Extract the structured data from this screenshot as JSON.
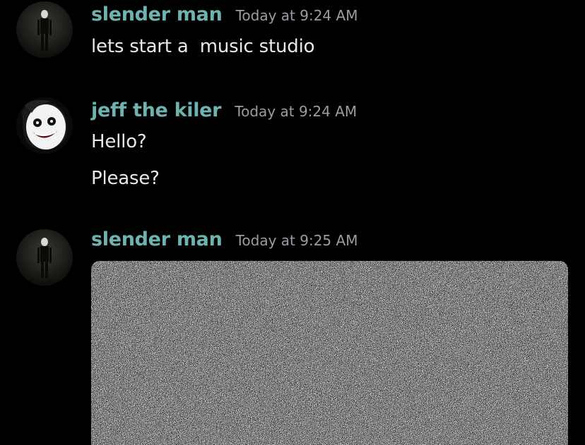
{
  "messages": [
    {
      "author": "slender man",
      "timestamp": "Today at 9:24 AM",
      "avatar_icon": "slender-man-avatar",
      "lines": [
        "lets start a  music studio"
      ]
    },
    {
      "author": "jeff the kiler",
      "timestamp": "Today at 9:24 AM",
      "avatar_icon": "jeff-the-killer-avatar",
      "lines": [
        "Hello?",
        "Please?"
      ]
    },
    {
      "author": "slender man",
      "timestamp": "Today at 9:25 AM",
      "avatar_icon": "slender-man-avatar",
      "attachment": "tv-static-image"
    }
  ],
  "colors": {
    "background": "#000000",
    "username": "#6fb3b0",
    "timestamp": "#9a9da3",
    "text": "#e8e9ea"
  }
}
